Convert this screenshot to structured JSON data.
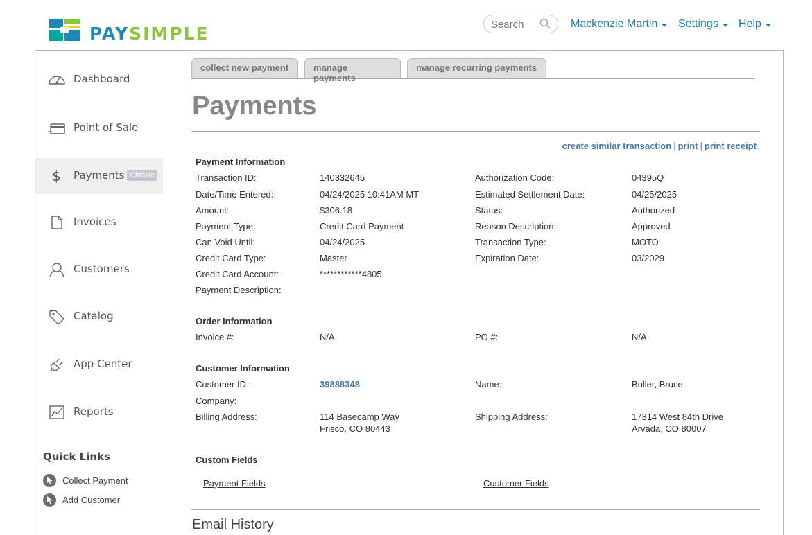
{
  "brand": {
    "pay": "PAY",
    "simple": "SIMPLE",
    "colors": {
      "blue": "#1e88b6",
      "green": "#8cc63f",
      "teal": "#00a79d",
      "yellow": "#f7d117"
    }
  },
  "header": {
    "search_placeholder": "Search",
    "user_menu": "Mackenzie Martin",
    "settings_menu": "Settings",
    "help_menu": "Help"
  },
  "sidebar": {
    "items": [
      {
        "label": "Dashboard",
        "icon": "dashboard-icon"
      },
      {
        "label": "Point of Sale",
        "icon": "card-reader-icon"
      },
      {
        "label": "Payments",
        "icon": "dollar-icon",
        "badge": "Classic",
        "active": true
      },
      {
        "label": "Invoices",
        "icon": "document-icon"
      },
      {
        "label": "Customers",
        "icon": "person-icon"
      },
      {
        "label": "Catalog",
        "icon": "tag-icon"
      },
      {
        "label": "App Center",
        "icon": "plug-icon"
      },
      {
        "label": "Reports",
        "icon": "chart-icon"
      }
    ],
    "quick_links_title": "Quick Links",
    "quick_links": [
      "Collect Payment",
      "Add Customer"
    ]
  },
  "tabs": [
    "collect new payment",
    "manage payments",
    "manage recurring payments"
  ],
  "page_title": "Payments",
  "actions": {
    "similar": "create similar transaction",
    "print": "print",
    "print_receipt": "print receipt",
    "separator": "|"
  },
  "payment_info": {
    "title": "Payment Information",
    "left": [
      {
        "label": "Transaction ID:",
        "value": "140332645"
      },
      {
        "label": "Date/Time Entered:",
        "value": "04/24/2025 10:41AM MT"
      },
      {
        "label": "Amount:",
        "value": "$306.18"
      },
      {
        "label": "Payment Type:",
        "value": "Credit Card Payment"
      },
      {
        "label": "Can Void Until:",
        "value": "04/24/2025"
      },
      {
        "label": "Credit Card Type:",
        "value": "Master"
      },
      {
        "label": "Credit Card Account:",
        "value": "************4805"
      },
      {
        "label": "Payment Description:",
        "value": ""
      }
    ],
    "right": [
      {
        "label": "Authorization Code:",
        "value": "04395Q"
      },
      {
        "label": "Estimated Settlement Date:",
        "value": "04/25/2025"
      },
      {
        "label": "Status:",
        "value": "Authorized"
      },
      {
        "label": "Reason Description:",
        "value": "Approved"
      },
      {
        "label": "Transaction Type:",
        "value": "MOTO"
      },
      {
        "label": "Expiration Date:",
        "value": "03/2029"
      }
    ]
  },
  "order_info": {
    "title": "Order Information",
    "invoice_label": "Invoice #:",
    "invoice_value": "N/A",
    "po_label": "PO #:",
    "po_value": "N/A"
  },
  "customer_info": {
    "title": "Customer Information",
    "id_label": "Customer ID :",
    "id_value": "39888348",
    "name_label": "Name:",
    "name_value": "Buller, Bruce",
    "company_label": "Company:",
    "billing_label": "Billing Address:",
    "billing_line1": "114 Basecamp Way",
    "billing_line2": "Frisco, CO 80443",
    "shipping_label": "Shipping Address:",
    "shipping_line1": "17314 West 84th Drive",
    "shipping_line2": "Arvada, CO 80007"
  },
  "custom_fields": {
    "title": "Custom Fields",
    "payment_fields": "Payment Fields",
    "customer_fields": "Customer Fields"
  },
  "email_history": "Email History"
}
